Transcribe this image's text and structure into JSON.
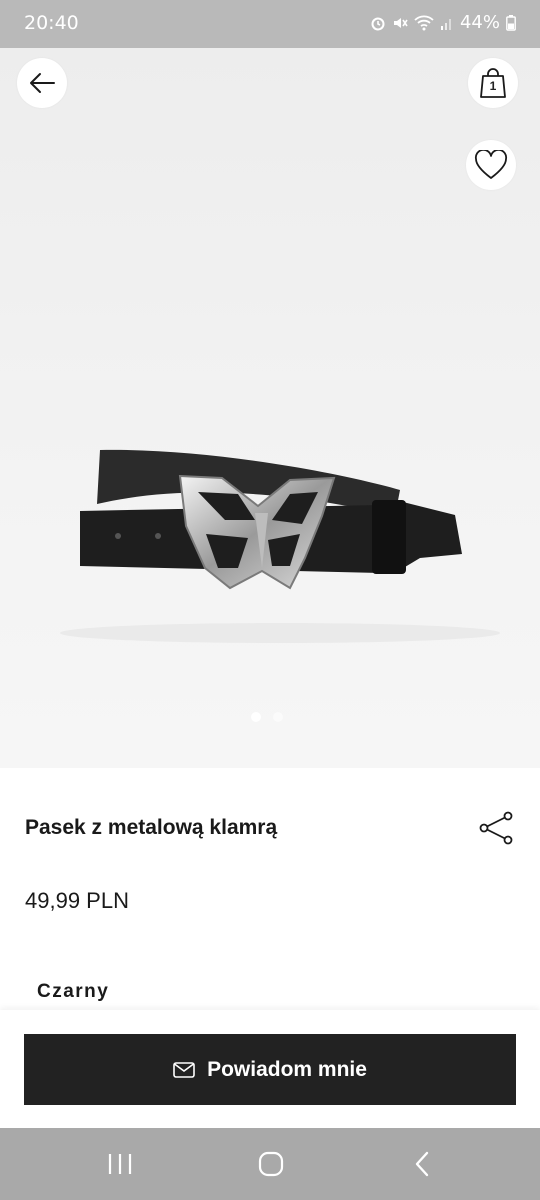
{
  "status_bar": {
    "time": "20:40",
    "battery": "44%",
    "icons": [
      "alarm-icon",
      "mute-icon",
      "wifi-icon",
      "signal-icon",
      "battery-icon"
    ]
  },
  "header": {
    "back_icon": "arrow-left-icon",
    "bag_icon": "shopping-bag-icon",
    "bag_count": "1",
    "favorite_icon": "heart-icon"
  },
  "gallery": {
    "images": [
      "product-image-1",
      "product-image-2"
    ],
    "active_index": 0
  },
  "product": {
    "title": "Pasek z metalową klamrą",
    "price": "49,99 PLN",
    "color": "Czarny",
    "share_icon": "share-icon"
  },
  "cta": {
    "label": "Powiadom mnie",
    "icon": "mail-icon"
  },
  "colors": {
    "status_bar": "#b9b9b9",
    "nav_bar": "#a9a9a9",
    "button": "#222222",
    "text": "#1a1a1a"
  }
}
